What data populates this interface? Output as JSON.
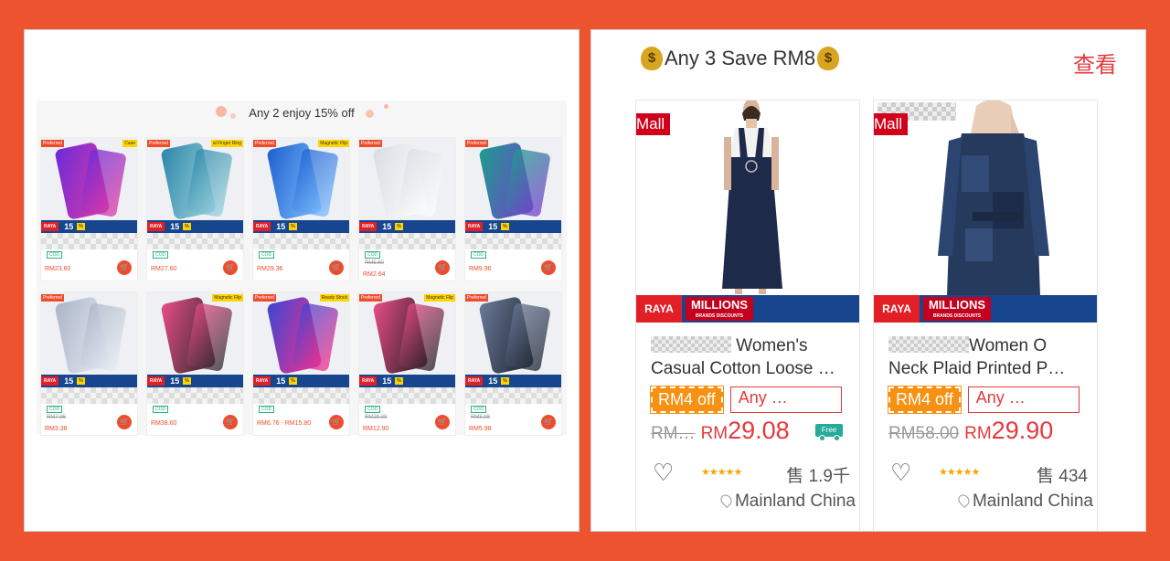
{
  "left": {
    "promo_title": "Any 2 enjoy 15% off",
    "cards": [
      {
        "pref": "Preferred",
        "tag": "Case",
        "cod": "COD",
        "old": "",
        "price": "RM23.60",
        "c1": "#6a2bd9",
        "c2": "#e23aa4"
      },
      {
        "pref": "Preferred",
        "tag": "al Finger Ring",
        "cod": "COD",
        "old": "",
        "price": "RM27.60",
        "c1": "#2c86a8",
        "c2": "#9ed4e0"
      },
      {
        "pref": "Preferred",
        "tag": "Magnetic Flip",
        "cod": "COD",
        "old": "",
        "price": "RM29.36",
        "c1": "#1f5fd0",
        "c2": "#7fc0ff"
      },
      {
        "pref": "Preferred",
        "tag": "",
        "cod": "COD",
        "old": "RM5.60",
        "price": "RM2.64",
        "c1": "#d9dde3",
        "c2": "#ffffff"
      },
      {
        "pref": "Preferred",
        "tag": "",
        "cod": "COD",
        "old": "",
        "price": "RM9.96",
        "c1": "#1a9e8c",
        "c2": "#7a3bd1"
      },
      {
        "pref": "Preferred",
        "tag": "",
        "cod": "COD",
        "old": "RM7.96",
        "price": "RM3.38",
        "c1": "#aab4c7",
        "c2": "#e7ecf4"
      },
      {
        "pref": "",
        "tag": "Magnetic Flip",
        "cod": "COD",
        "old": "",
        "price": "RM38.60",
        "c1": "#ea4c89",
        "c2": "#2a2a2a"
      },
      {
        "pref": "Preferred",
        "tag": "Ready Stock",
        "cod": "COD",
        "old": "",
        "price": "RM6.76 - RM15.80",
        "c1": "#3a47d5",
        "c2": "#ff2e88"
      },
      {
        "pref": "Preferred",
        "tag": "Magnetic Flip",
        "cod": "COD",
        "old": "RM29.38",
        "price": "RM12.90",
        "c1": "#ea4c89",
        "c2": "#1f1f1f"
      },
      {
        "pref": "Preferred",
        "tag": "",
        "cod": "COD",
        "old": "RM8.98",
        "price": "RM5.98",
        "c1": "#6b7a99",
        "c2": "#1d2330"
      }
    ],
    "banner_raya": "RAYA",
    "banner_15": "15"
  },
  "right": {
    "title": "Any 3 Save RM8",
    "link_text": "查看",
    "products": [
      {
        "mall": "Mall",
        "name": " Women's Casual Cotton Loose …",
        "off": "RM4 off",
        "any": "Any …",
        "old_price": "RM…",
        "currency": "RM",
        "price": "29.08",
        "free": "Free",
        "stars": "★★★★★",
        "sold": "售 1.9千",
        "location": "Mainland China",
        "dress_color": "#1d2a4a"
      },
      {
        "mall": "Mall",
        "name": "Women O Neck Plaid Printed P…",
        "off": "RM4 off",
        "any": "Any …",
        "old_price": "RM58.00",
        "currency": "RM",
        "price": "29.90",
        "free": "",
        "stars": "★★★★★",
        "sold": "售 434",
        "location": "Mainland China",
        "dress_color": "#263a5e"
      }
    ],
    "raya": "RAYA",
    "millions": "MILLIONS",
    "millions_sub": "BRANDS DISCOUNTS"
  }
}
